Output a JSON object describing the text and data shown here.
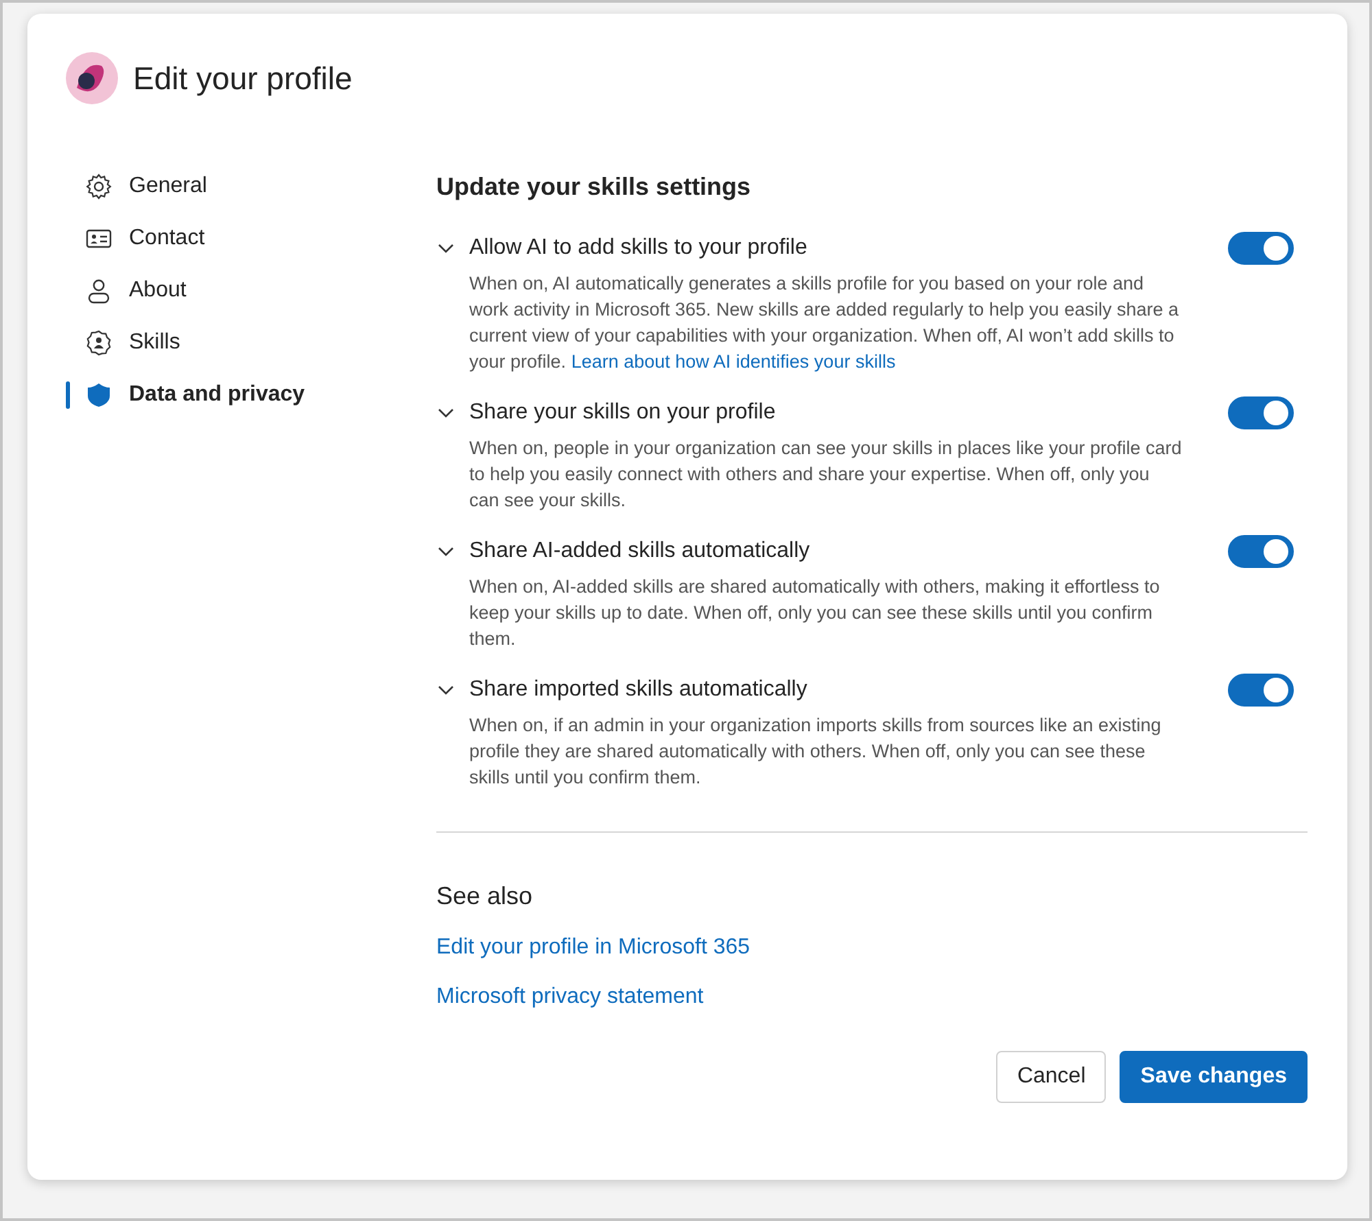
{
  "header": {
    "title": "Edit your profile"
  },
  "sidebar": {
    "items": [
      {
        "label": "General",
        "kind": "gear",
        "selected": false
      },
      {
        "label": "Contact",
        "kind": "card",
        "selected": false
      },
      {
        "label": "About",
        "kind": "person",
        "selected": false
      },
      {
        "label": "Skills",
        "kind": "badge",
        "selected": false
      },
      {
        "label": "Data and privacy",
        "kind": "shield",
        "selected": true
      }
    ]
  },
  "section_title": "Update your skills settings",
  "settings": [
    {
      "title": "Allow AI to add skills to your profile",
      "expanded": true,
      "on": true,
      "description": "When on, AI automatically generates a skills profile for you based on your role and work activity in Microsoft 365. New skills are added regularly to help you easily share a current view of your capabilities with your organization. When off, AI won’t add skills to your profile.",
      "link": "Learn about how AI identifies your skills"
    },
    {
      "title": "Share your skills on your profile",
      "expanded": true,
      "on": true,
      "description": "When on, people in your organization can see your skills in places like your profile card to help you easily connect with others and share your expertise. When off, only you can see your skills."
    },
    {
      "title": "Share AI-added skills automatically",
      "expanded": true,
      "on": true,
      "description": "When on, AI-added skills are shared automatically with others, making it effortless to keep your skills up to date. When off, only you can see these skills until you confirm them."
    },
    {
      "title": "Share imported skills automatically",
      "expanded": true,
      "on": true,
      "description": "When on, if an admin in your organization imports skills from sources like an existing profile they are shared automatically with others. When off, only you can see these skills until you confirm them."
    }
  ],
  "see_also": {
    "title": "See also",
    "links": [
      "Edit your profile in Microsoft 365",
      "Microsoft privacy statement"
    ]
  },
  "buttons": {
    "cancel": "Cancel",
    "save": "Save changes"
  }
}
